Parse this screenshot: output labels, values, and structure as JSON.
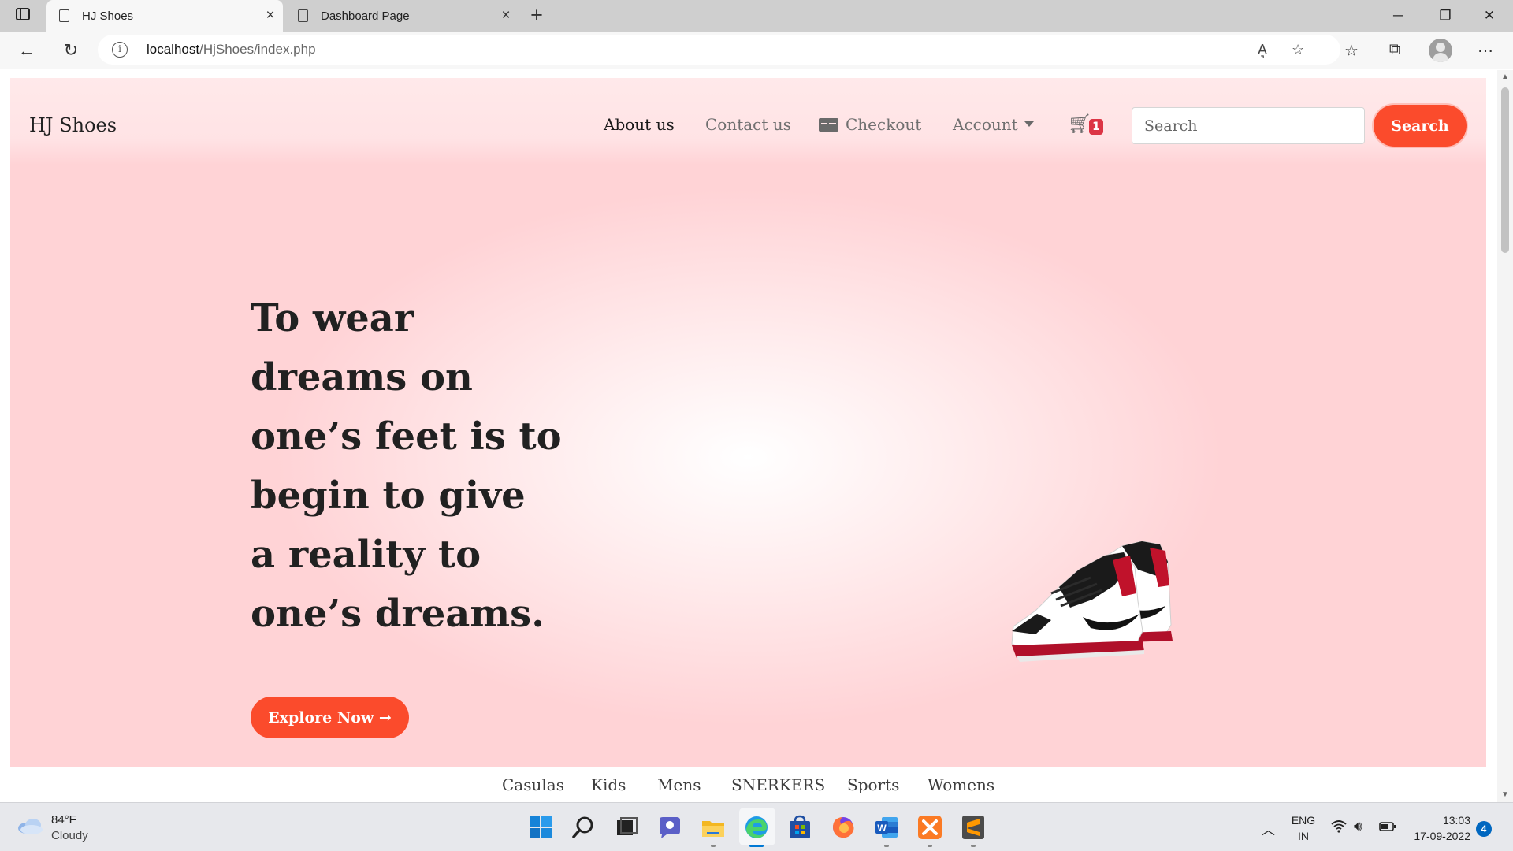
{
  "browser": {
    "tabs": [
      {
        "title": "HJ Shoes",
        "active": true
      },
      {
        "title": "Dashboard Page",
        "active": false
      }
    ],
    "url_host": "localhost",
    "url_path": "/HjShoes/index.php",
    "window_controls": {
      "minimize": "─",
      "restore": "❐",
      "close": "✕"
    },
    "read_aloud": "A͉"
  },
  "site": {
    "brand": "HJ Shoes",
    "nav": {
      "about": "About us",
      "contact": "Contact us",
      "checkout": "Checkout",
      "account": "Account",
      "cart_count": "1"
    },
    "search": {
      "placeholder": "Search",
      "button": "Search"
    },
    "hero": {
      "headline_lines": [
        "To wear",
        "dreams on",
        "one’s feet is to",
        "begin to give",
        "a reality to",
        "one’s dreams."
      ],
      "cta": "Explore Now →"
    },
    "categories": [
      "Casulas",
      "Kids",
      "Mens",
      "SNERKERS",
      "Sports",
      "Womens"
    ],
    "colors": {
      "accent": "#fb4b2c",
      "hero_bg": "#ffd3d6",
      "badge": "#dc3545"
    }
  },
  "taskbar": {
    "weather": {
      "temp": "84°F",
      "condition": "Cloudy"
    },
    "language": {
      "line1": "ENG",
      "line2": "IN"
    },
    "clock": {
      "time": "13:03",
      "date": "17-09-2022"
    },
    "notifications": "4",
    "apps": [
      "start",
      "search",
      "task-view",
      "chat",
      "file-explorer",
      "edge",
      "store",
      "firefox",
      "word",
      "xampp",
      "sublime-text"
    ]
  }
}
